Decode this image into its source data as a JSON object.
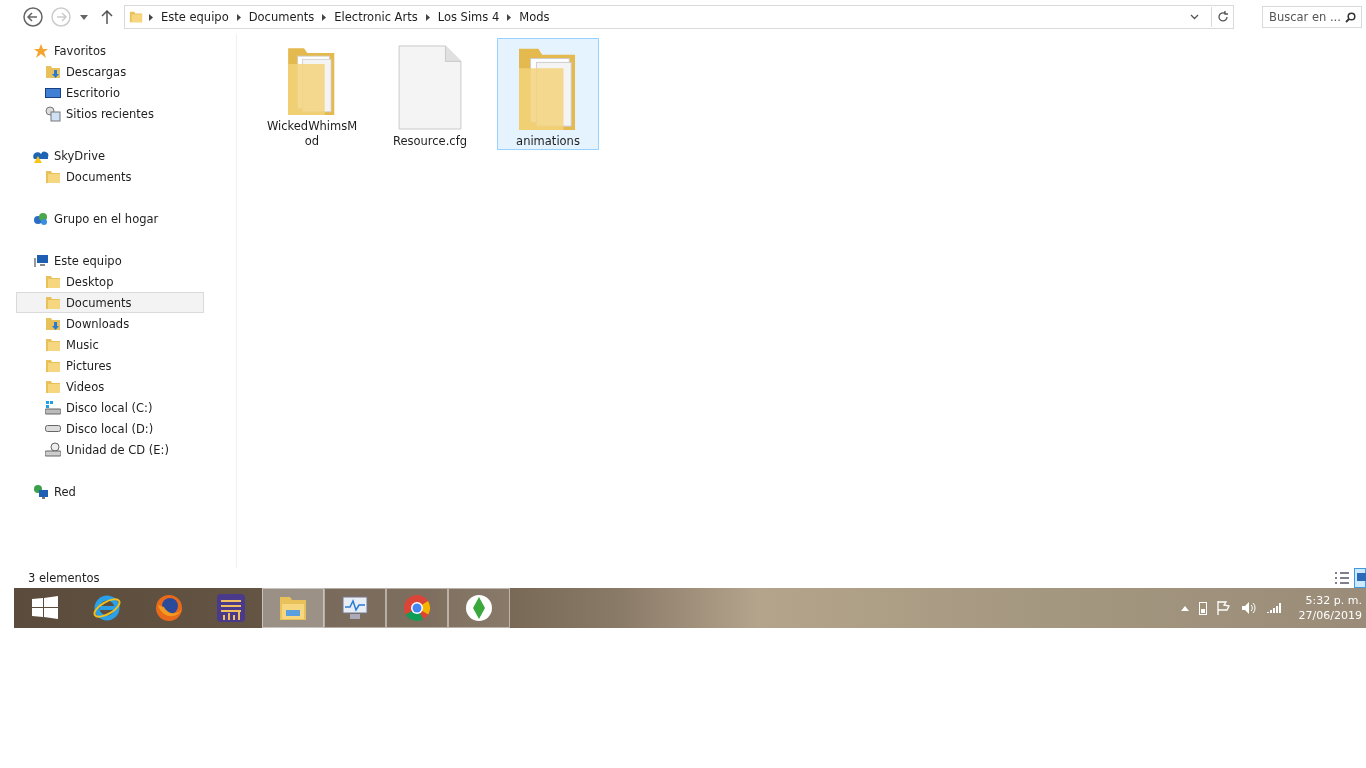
{
  "address_bar": {
    "crumbs": [
      "Este equipo",
      "Documents",
      "Electronic Arts",
      "Los Sims 4",
      "Mods"
    ]
  },
  "search": {
    "placeholder": "Buscar en ..."
  },
  "sidebar": {
    "groups": [
      {
        "kind": "favorites",
        "label": "Favoritos",
        "selected": false,
        "items": [
          {
            "kind": "download",
            "label": "Descargas",
            "selected": false
          },
          {
            "kind": "desktop",
            "label": "Escritorio",
            "selected": false
          },
          {
            "kind": "recent",
            "label": "Sitios recientes",
            "selected": false
          }
        ]
      },
      {
        "kind": "cloud",
        "label": "SkyDrive",
        "selected": false,
        "items": [
          {
            "kind": "folder",
            "label": "Documents",
            "selected": false
          }
        ]
      },
      {
        "kind": "homegroup",
        "label": "Grupo en el hogar",
        "selected": false
      },
      {
        "kind": "computer",
        "label": "Este equipo",
        "selected": false,
        "items": [
          {
            "kind": "desktop-folder",
            "label": "Desktop",
            "selected": false
          },
          {
            "kind": "docs-folder",
            "label": "Documents",
            "selected": true
          },
          {
            "kind": "download",
            "label": "Downloads",
            "selected": false
          },
          {
            "kind": "music-folder",
            "label": "Music",
            "selected": false
          },
          {
            "kind": "pictures-folder",
            "label": "Pictures",
            "selected": false
          },
          {
            "kind": "videos-folder",
            "label": "Videos",
            "selected": false
          },
          {
            "kind": "drive-c",
            "label": "Disco local (C:)",
            "selected": false
          },
          {
            "kind": "drive",
            "label": "Disco local (D:)",
            "selected": false
          },
          {
            "kind": "cd",
            "label": "Unidad de CD (E:)",
            "selected": false
          }
        ]
      },
      {
        "kind": "network",
        "label": "Red",
        "selected": false
      }
    ]
  },
  "files": [
    {
      "kind": "folder",
      "name": "WickedWhimsMod",
      "selected": false
    },
    {
      "kind": "file",
      "name": "Resource.cfg",
      "selected": false
    },
    {
      "kind": "folder",
      "name": "animations",
      "selected": true
    }
  ],
  "status_bar": {
    "count": "3 elementos"
  },
  "taskbar": {
    "apps": [
      {
        "kind": "start",
        "open": false,
        "selected": false
      },
      {
        "kind": "browser-e",
        "open": false,
        "selected": false
      },
      {
        "kind": "browser-fox",
        "open": false,
        "selected": false
      },
      {
        "kind": "sliders",
        "open": false,
        "selected": false
      },
      {
        "kind": "explorer",
        "open": true,
        "selected": true
      },
      {
        "kind": "monitor",
        "open": true,
        "selected": false
      },
      {
        "kind": "browser-circle",
        "open": true,
        "selected": false
      },
      {
        "kind": "diamond",
        "open": true,
        "selected": false
      }
    ],
    "time": "5:32 p. m.",
    "date": "27/06/2019"
  }
}
